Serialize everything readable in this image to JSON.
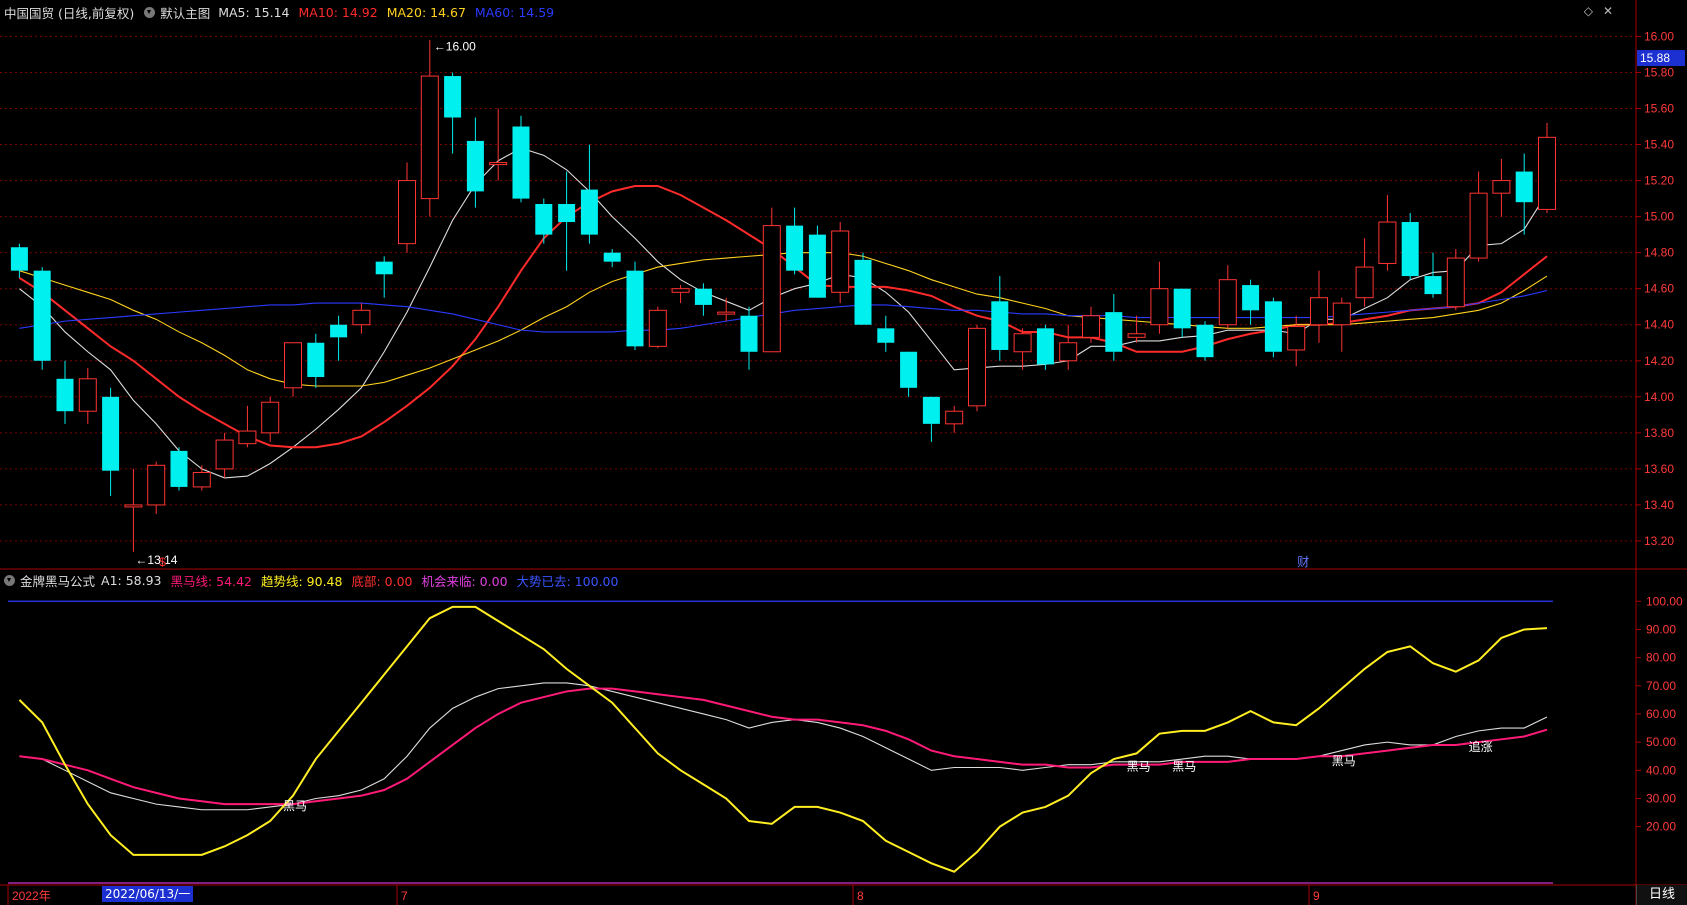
{
  "header": {
    "stock_title": "中国国贸 (日线,前复权)",
    "view_label": "默认主图",
    "ma_items": [
      {
        "label": "MA5: 15.14",
        "color": "#dddddd"
      },
      {
        "label": "MA10: 14.92",
        "color": "#ff2a2a"
      },
      {
        "label": "MA20: 14.67",
        "color": "#ffd21e"
      },
      {
        "label": "MA60: 14.59",
        "color": "#2b3aff"
      }
    ]
  },
  "indicator": {
    "name": "金牌黑马公式",
    "items": [
      {
        "label": "A1: 58.93",
        "color": "#dddddd"
      },
      {
        "label": "黑马线: 54.42",
        "color": "#ff1a78"
      },
      {
        "label": "趋势线: 90.48",
        "color": "#ffee22"
      },
      {
        "label": "底部: 0.00",
        "color": "#ff3030"
      },
      {
        "label": "机会来临: 0.00",
        "color": "#e040e0"
      },
      {
        "label": "大势已去: 100.00",
        "color": "#3a55ff"
      }
    ]
  },
  "current_price_tag": "15.88",
  "date_tag": "2022/06/13/一",
  "period_tab": "日线",
  "colors": {
    "up": "#ff3333",
    "down": "#00f0f0",
    "grid": "#7a0000",
    "axis": "#aa0000"
  },
  "chart_data": [
    {
      "type": "candlestick",
      "price_ticks": [
        13.2,
        13.4,
        13.6,
        13.8,
        14.0,
        14.2,
        14.4,
        14.6,
        14.8,
        15.0,
        15.2,
        15.4,
        15.6,
        15.8,
        16.0
      ],
      "ylim": [
        13.05,
        16.08
      ],
      "annotations": {
        "high": "16.00",
        "low": "13.14",
        "event_marks": [
          "$",
          "财"
        ]
      },
      "x_labels": [
        "2022年",
        "7",
        "8",
        "9"
      ],
      "candles": [
        [
          14.83,
          14.7,
          14.85,
          14.66
        ],
        [
          14.7,
          14.2,
          14.72,
          14.15
        ],
        [
          14.1,
          13.92,
          14.2,
          13.85
        ],
        [
          13.92,
          14.1,
          14.16,
          13.85
        ],
        [
          14.0,
          13.59,
          14.05,
          13.45
        ],
        [
          13.4,
          13.4,
          13.6,
          13.14
        ],
        [
          13.4,
          13.62,
          13.64,
          13.35
        ],
        [
          13.7,
          13.5,
          13.72,
          13.48
        ],
        [
          13.5,
          13.58,
          13.62,
          13.48
        ],
        [
          13.6,
          13.76,
          13.8,
          13.55
        ],
        [
          13.74,
          13.81,
          13.95,
          13.72
        ],
        [
          13.8,
          13.97,
          14.0,
          13.75
        ],
        [
          14.05,
          14.3,
          14.3,
          14.0
        ],
        [
          14.3,
          14.11,
          14.35,
          14.05
        ],
        [
          14.4,
          14.33,
          14.45,
          14.2
        ],
        [
          14.4,
          14.48,
          14.52,
          14.35
        ],
        [
          14.75,
          14.68,
          14.78,
          14.55
        ],
        [
          14.85,
          15.2,
          15.3,
          14.8
        ],
        [
          15.1,
          15.78,
          15.98,
          15.0
        ],
        [
          15.78,
          15.55,
          15.8,
          15.35
        ],
        [
          15.42,
          15.14,
          15.55,
          15.05
        ],
        [
          15.3,
          15.3,
          15.6,
          15.2
        ],
        [
          15.5,
          15.1,
          15.56,
          15.08
        ],
        [
          15.07,
          14.9,
          15.1,
          14.85
        ],
        [
          15.07,
          14.97,
          15.25,
          14.7
        ],
        [
          15.15,
          14.9,
          15.4,
          14.85
        ],
        [
          14.8,
          14.75,
          14.82,
          14.72
        ],
        [
          14.7,
          14.28,
          14.75,
          14.26
        ],
        [
          14.28,
          14.48,
          14.5,
          14.27
        ],
        [
          14.58,
          14.6,
          14.62,
          14.52
        ],
        [
          14.6,
          14.51,
          14.63,
          14.45
        ],
        [
          14.47,
          14.47,
          14.55,
          14.42
        ],
        [
          14.45,
          14.25,
          14.5,
          14.15
        ],
        [
          14.25,
          14.95,
          15.05,
          14.25
        ],
        [
          14.95,
          14.7,
          15.05,
          14.68
        ],
        [
          14.9,
          14.55,
          14.95,
          14.55
        ],
        [
          14.58,
          14.92,
          14.97,
          14.52
        ],
        [
          14.76,
          14.4,
          14.8,
          14.4
        ],
        [
          14.38,
          14.3,
          14.45,
          14.25
        ],
        [
          14.25,
          14.05,
          14.25,
          14.0
        ],
        [
          14.0,
          13.85,
          14.0,
          13.75
        ],
        [
          13.85,
          13.92,
          13.95,
          13.8
        ],
        [
          13.95,
          14.38,
          14.4,
          13.92
        ],
        [
          14.53,
          14.26,
          14.67,
          14.2
        ],
        [
          14.25,
          14.35,
          14.38,
          14.15
        ],
        [
          14.38,
          14.18,
          14.4,
          14.15
        ],
        [
          14.2,
          14.3,
          14.4,
          14.15
        ],
        [
          14.33,
          14.45,
          14.5,
          14.3
        ],
        [
          14.47,
          14.25,
          14.57,
          14.2
        ],
        [
          14.33,
          14.35,
          14.45,
          14.3
        ],
        [
          14.4,
          14.6,
          14.75,
          14.35
        ],
        [
          14.6,
          14.38,
          14.6,
          14.33
        ],
        [
          14.4,
          14.22,
          14.42,
          14.2
        ],
        [
          14.4,
          14.65,
          14.73,
          14.38
        ],
        [
          14.62,
          14.48,
          14.65,
          14.4
        ],
        [
          14.53,
          14.25,
          14.55,
          14.22
        ],
        [
          14.26,
          14.39,
          14.45,
          14.17
        ],
        [
          14.4,
          14.55,
          14.7,
          14.3
        ],
        [
          14.4,
          14.52,
          14.55,
          14.25
        ],
        [
          14.55,
          14.72,
          14.88,
          14.5
        ],
        [
          14.74,
          14.97,
          15.12,
          14.7
        ],
        [
          14.97,
          14.67,
          15.02,
          14.65
        ],
        [
          14.67,
          14.57,
          14.8,
          14.55
        ],
        [
          14.5,
          14.77,
          14.82,
          14.48
        ],
        [
          14.77,
          15.13,
          15.25,
          14.75
        ],
        [
          15.13,
          15.2,
          15.32,
          15.0
        ],
        [
          15.25,
          15.08,
          15.35,
          14.9
        ],
        [
          15.04,
          15.44,
          15.52,
          15.02
        ]
      ],
      "ma_lines": [
        {
          "name": "MA5",
          "color": "#dddddd",
          "values": [
            14.6,
            14.5,
            14.36,
            14.25,
            14.15,
            13.98,
            13.85,
            13.7,
            13.6,
            13.55,
            13.56,
            13.63,
            13.72,
            13.82,
            13.93,
            14.05,
            14.25,
            14.47,
            14.72,
            14.98,
            15.18,
            15.31,
            15.38,
            15.34,
            15.26,
            15.14,
            15.0,
            14.88,
            14.75,
            14.65,
            14.58,
            14.53,
            14.48,
            14.55,
            14.6,
            14.63,
            14.68,
            14.66,
            14.58,
            14.47,
            14.31,
            14.15,
            14.16,
            14.17,
            14.17,
            14.18,
            14.2,
            14.28,
            14.28,
            14.31,
            14.31,
            14.33,
            14.34,
            14.37,
            14.37,
            14.37,
            14.35,
            14.43,
            14.43,
            14.49,
            14.55,
            14.65,
            14.69,
            14.7,
            14.84,
            14.85,
            14.93,
            15.13
          ]
        },
        {
          "name": "MA10",
          "color": "#ff2a2a",
          "values": [
            14.66,
            14.58,
            14.48,
            14.38,
            14.28,
            14.2,
            14.1,
            14.0,
            13.92,
            13.85,
            13.78,
            13.73,
            13.72,
            13.72,
            13.74,
            13.78,
            13.86,
            13.95,
            14.05,
            14.17,
            14.32,
            14.5,
            14.7,
            14.88,
            15.0,
            15.08,
            15.14,
            15.17,
            15.17,
            15.12,
            15.05,
            14.98,
            14.9,
            14.82,
            14.72,
            14.62,
            14.61,
            14.61,
            14.61,
            14.59,
            14.56,
            14.5,
            14.45,
            14.42,
            14.36,
            14.36,
            14.33,
            14.33,
            14.3,
            14.25,
            14.25,
            14.25,
            14.28,
            14.32,
            14.35,
            14.37,
            14.4,
            14.4,
            14.41,
            14.43,
            14.45,
            14.48,
            14.49,
            14.5,
            14.52,
            14.58,
            14.68,
            14.78
          ]
        },
        {
          "name": "MA20",
          "color": "#ffd21e",
          "values": [
            14.7,
            14.66,
            14.62,
            14.58,
            14.54,
            14.48,
            14.43,
            14.36,
            14.3,
            14.23,
            14.15,
            14.1,
            14.07,
            14.06,
            14.06,
            14.06,
            14.08,
            14.12,
            14.16,
            14.21,
            14.26,
            14.31,
            14.37,
            14.44,
            14.5,
            14.58,
            14.64,
            14.68,
            14.72,
            14.74,
            14.76,
            14.77,
            14.78,
            14.79,
            14.8,
            14.8,
            14.8,
            14.78,
            14.74,
            14.7,
            14.65,
            14.61,
            14.57,
            14.55,
            14.52,
            14.49,
            14.45,
            14.44,
            14.43,
            14.42,
            14.41,
            14.4,
            14.39,
            14.38,
            14.38,
            14.39,
            14.4,
            14.4,
            14.4,
            14.41,
            14.42,
            14.43,
            14.44,
            14.46,
            14.48,
            14.52,
            14.59,
            14.67
          ]
        },
        {
          "name": "MA60",
          "color": "#2b3aff",
          "values": [
            14.38,
            14.4,
            14.42,
            14.43,
            14.44,
            14.45,
            14.46,
            14.47,
            14.48,
            14.49,
            14.5,
            14.51,
            14.51,
            14.52,
            14.52,
            14.52,
            14.51,
            14.5,
            14.48,
            14.46,
            14.43,
            14.4,
            14.37,
            14.36,
            14.36,
            14.36,
            14.36,
            14.37,
            14.37,
            14.38,
            14.4,
            14.42,
            14.44,
            14.46,
            14.48,
            14.49,
            14.5,
            14.51,
            14.51,
            14.5,
            14.49,
            14.48,
            14.48,
            14.47,
            14.46,
            14.46,
            14.45,
            14.45,
            14.45,
            14.44,
            14.44,
            14.44,
            14.44,
            14.44,
            14.44,
            14.44,
            14.44,
            14.44,
            14.45,
            14.46,
            14.47,
            14.48,
            14.49,
            14.5,
            14.52,
            14.54,
            14.56,
            14.59
          ]
        }
      ]
    },
    {
      "type": "line",
      "title": "金牌黑马公式",
      "y_ticks": [
        20.0,
        30.0,
        40.0,
        50.0,
        60.0,
        70.0,
        80.0,
        90.0,
        100.0
      ],
      "ylim": [
        0,
        104
      ],
      "reference_lines": [
        {
          "value": 100,
          "color": "#2b3aff"
        },
        {
          "value": 0,
          "color": "#cc33cc"
        }
      ],
      "labels": [
        {
          "text": "黑马",
          "index": 12,
          "value": 28
        },
        {
          "text": "黑马",
          "index": 49,
          "value": 42
        },
        {
          "text": "黑马",
          "index": 51,
          "value": 42
        },
        {
          "text": "黑马",
          "index": 58,
          "value": 44
        },
        {
          "text": "追涨",
          "index": 64,
          "value": 49
        }
      ],
      "series": [
        {
          "name": "A1",
          "color": "#dddddd",
          "values": [
            45,
            44,
            40,
            36,
            32,
            30,
            28,
            27,
            26,
            26,
            26,
            27,
            28,
            30,
            31,
            33,
            37,
            45,
            55,
            62,
            66,
            69,
            70,
            71,
            71,
            70,
            68,
            66,
            64,
            62,
            60,
            58,
            55,
            57,
            58,
            57,
            55,
            52,
            48,
            44,
            40,
            41,
            41,
            41,
            40,
            41,
            42,
            42,
            43,
            43,
            43,
            44,
            45,
            45,
            44,
            44,
            44,
            45,
            47,
            49,
            50,
            49,
            49,
            52,
            54,
            55,
            55,
            58.93
          ]
        },
        {
          "name": "黑马线",
          "color": "#ff1a78",
          "values": [
            45,
            44,
            42,
            40,
            37,
            34,
            32,
            30,
            29,
            28,
            28,
            28,
            28,
            29,
            30,
            31,
            33,
            37,
            43,
            49,
            55,
            60,
            64,
            66,
            68,
            69,
            69,
            68,
            67,
            66,
            65,
            63,
            61,
            59,
            58,
            58,
            57,
            56,
            54,
            51,
            47,
            45,
            44,
            43,
            42,
            42,
            41,
            41,
            42,
            42,
            42,
            43,
            43,
            43,
            44,
            44,
            44,
            45,
            45,
            46,
            47,
            48,
            49,
            49,
            50,
            51,
            52,
            54.42
          ]
        },
        {
          "name": "趋势线",
          "color": "#ffee22",
          "values": [
            65,
            57,
            42,
            28,
            17,
            10,
            10,
            10,
            10,
            13,
            17,
            22,
            31,
            44,
            54,
            64,
            74,
            84,
            94,
            98,
            98,
            93,
            88,
            83,
            76,
            70,
            64,
            55,
            46,
            40,
            35,
            30,
            22,
            21,
            27,
            27,
            25,
            22,
            15,
            11,
            7,
            4,
            11,
            20,
            25,
            27,
            31,
            39,
            44,
            46,
            53,
            54,
            54,
            57,
            61,
            57,
            56,
            62,
            69,
            76,
            82,
            84,
            78,
            75,
            79,
            87,
            90,
            90.48
          ]
        }
      ]
    }
  ]
}
